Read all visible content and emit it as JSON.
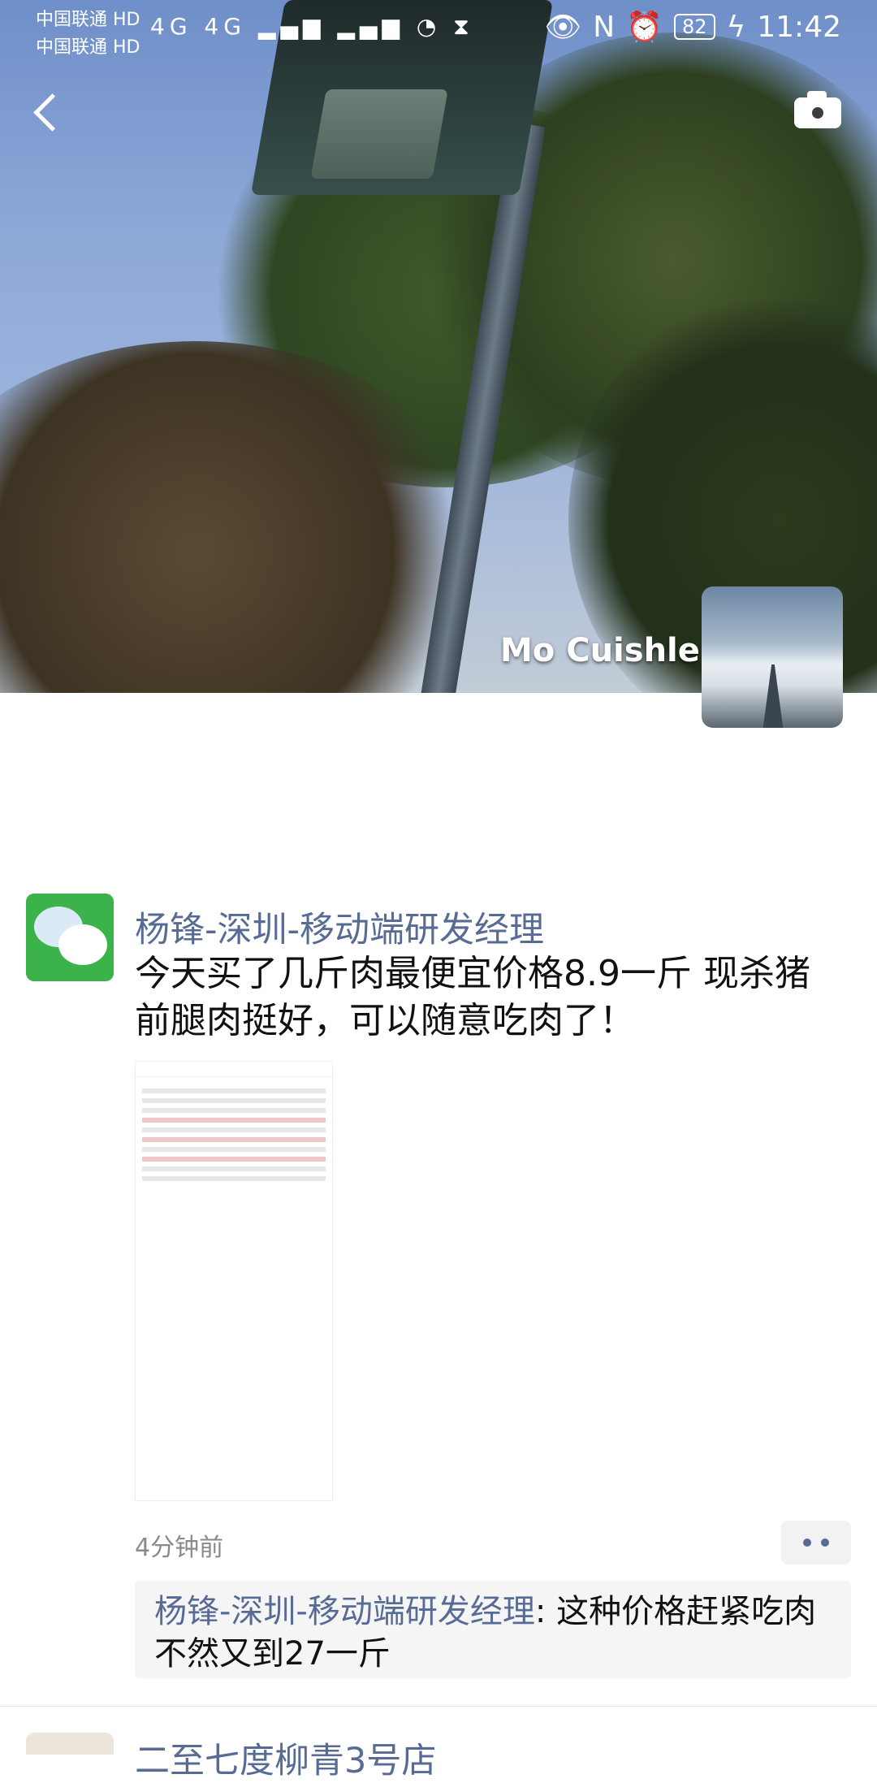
{
  "status_bar": {
    "carrier_line1": "中国联通 HD",
    "carrier_line2": "中国联通 HD",
    "signal_text": "4G 4G",
    "battery": "82",
    "time": "11:42"
  },
  "header": {
    "profile_name": "Mo Cuishle"
  },
  "post": {
    "author": "杨锋-深圳-移动端研发经理",
    "text": "今天买了几斤肉最便宜价格8.9一斤 现杀猪前腿肉挺好，可以随意吃肉了！",
    "time_ago": "4分钟前",
    "comment": {
      "author": "杨锋-深圳-移动端研发经理",
      "text": "这种价格赶紧吃肉不然又到27一斤"
    }
  },
  "next_post": {
    "author_partial": "二至七度柳青3号店"
  }
}
